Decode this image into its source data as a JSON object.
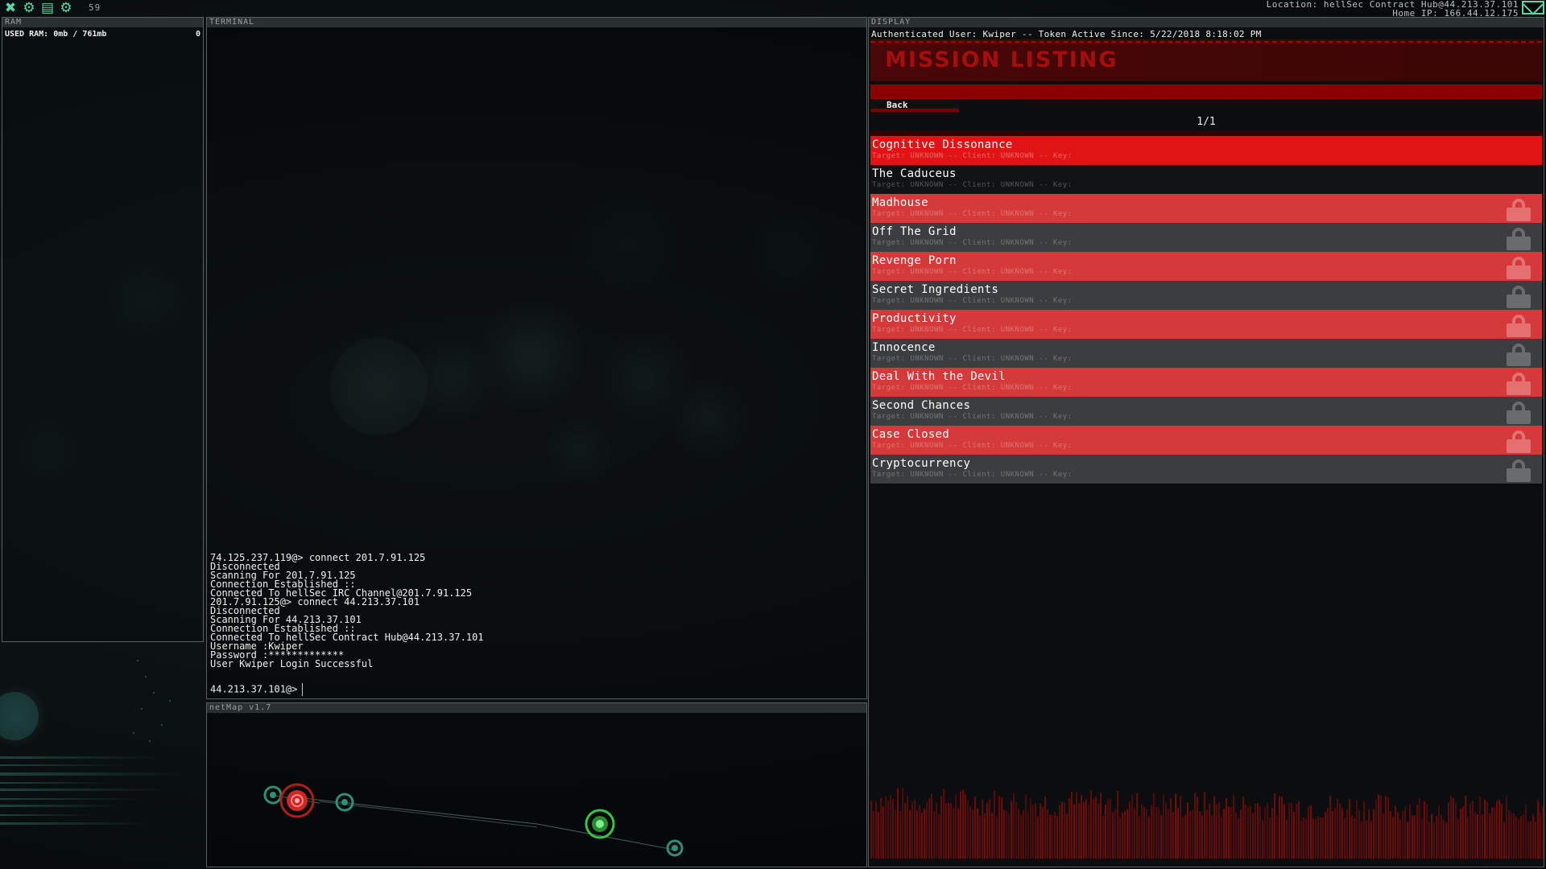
{
  "topbar": {
    "icons": [
      "close-icon",
      "gear-icon",
      "save-icon",
      "settings-icon"
    ],
    "fps": "59",
    "location_line": "Location: hellSec Contract Hub@44.213.37.101",
    "home_ip_line": "Home IP: 166.44.12.175"
  },
  "ram": {
    "header": "RAM",
    "used_label": "USED RAM: 0mb / 761mb",
    "count": "0"
  },
  "terminal": {
    "header": "TERMINAL",
    "lines": [
      "74.125.237.119@> connect 201.7.91.125",
      "Disconnected",
      "Scanning For 201.7.91.125",
      "Connection Established ::",
      "Connected To hellSec IRC Channel@201.7.91.125",
      "201.7.91.125@> connect 44.213.37.101",
      "Disconnected",
      "Scanning For 44.213.37.101",
      "Connection Established ::",
      "Connected To hellSec Contract Hub@44.213.37.101",
      "Username :Kwiper",
      "Password :*************",
      "User Kwiper Login Successful"
    ],
    "prompt": "44.213.37.101@>"
  },
  "netmap": {
    "header": "netMap v1.7"
  },
  "display": {
    "header": "DISPLAY",
    "auth_line": "Authenticated User: Kwiper -- Token Active Since: 5/22/2018 8:18:02 PM",
    "title": "MISSION LISTING",
    "back_label": "Back",
    "pager": "1/1",
    "meta_text": "Target: UNKNOWN -- Client: UNKNOWN -- Key:",
    "missions": [
      {
        "name": "Cognitive Dissonance",
        "style": "active",
        "locked": false
      },
      {
        "name": "The Caduceus",
        "style": "dark",
        "locked": false
      },
      {
        "name": "Madhouse",
        "style": "red",
        "locked": true
      },
      {
        "name": "Off The Grid",
        "style": "grey",
        "locked": true
      },
      {
        "name": "Revenge Porn",
        "style": "red",
        "locked": true
      },
      {
        "name": "Secret Ingredients",
        "style": "grey",
        "locked": true
      },
      {
        "name": "Productivity",
        "style": "red",
        "locked": true
      },
      {
        "name": "Innocence",
        "style": "grey",
        "locked": true
      },
      {
        "name": "Deal With the Devil",
        "style": "red",
        "locked": true
      },
      {
        "name": "Second Chances",
        "style": "grey",
        "locked": true
      },
      {
        "name": "Case Closed",
        "style": "red",
        "locked": true
      },
      {
        "name": "Cryptocurrency",
        "style": "grey",
        "locked": true
      }
    ]
  },
  "colors": {
    "accent": "#5fd6a8",
    "active_red": "#e01414",
    "row_red": "#d43a3a",
    "row_grey": "#3c3d3e",
    "header_red": "#a40e0e"
  }
}
